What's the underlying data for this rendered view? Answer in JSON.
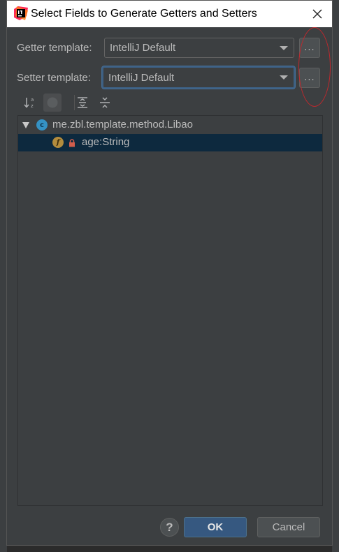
{
  "dialog": {
    "title": "Select Fields to Generate Getters and Setters",
    "close_icon": "close-icon"
  },
  "getter": {
    "label": "Getter template:",
    "value": "IntelliJ Default",
    "more_label": "..."
  },
  "setter": {
    "label": "Setter template:",
    "value": "IntelliJ Default",
    "more_label": "..."
  },
  "toolbar": {
    "icons": [
      "sort-alphabetically-icon",
      "show-classes-icon",
      "expand-all-icon",
      "collapse-all-icon"
    ]
  },
  "tree": {
    "class_node": {
      "badge": "c",
      "label": "me.zbl.template.method.Libao"
    },
    "field_node": {
      "badge": "f",
      "label": "age:String"
    }
  },
  "footer": {
    "help_label": "?",
    "ok_label": "OK",
    "cancel_label": "Cancel"
  },
  "colors": {
    "dialog_bg": "#3c3f41",
    "selection": "#0d293e",
    "primary_button": "#365880",
    "annotation": "#c0282d"
  }
}
